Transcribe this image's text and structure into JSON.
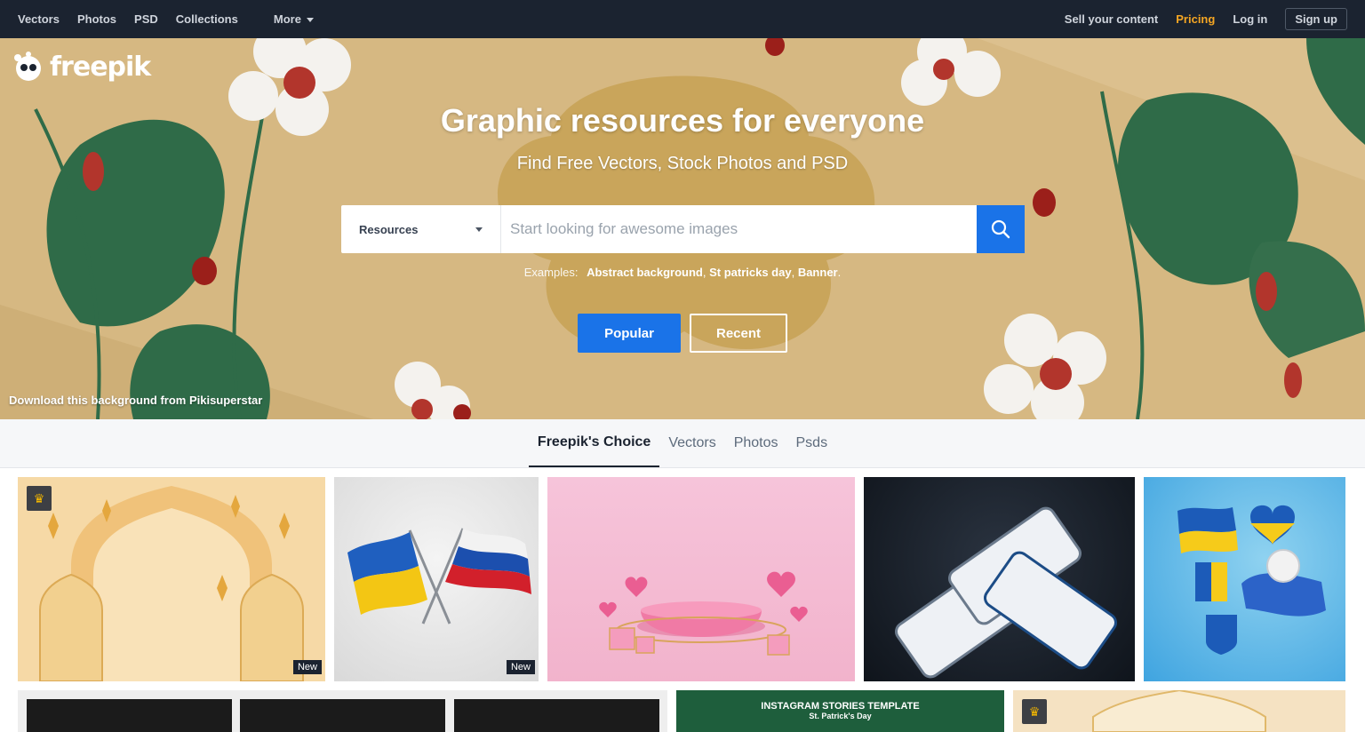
{
  "nav": {
    "left": [
      "Vectors",
      "Photos",
      "PSD",
      "Collections"
    ],
    "more_label": "More",
    "sell_label": "Sell your content",
    "pricing_label": "Pricing",
    "login_label": "Log in",
    "signup_label": "Sign up"
  },
  "brand": {
    "name": "freepik"
  },
  "hero": {
    "title": "Graphic resources for everyone",
    "subtitle": "Find Free Vectors, Stock Photos and PSD",
    "credit": "Download this background from Pikisuperstar"
  },
  "search": {
    "category": "Resources",
    "placeholder": "Start looking for awesome images",
    "value": ""
  },
  "examples": {
    "label": "Examples:",
    "items": [
      "Abstract background",
      "St patricks day",
      "Banner"
    ]
  },
  "hero_buttons": {
    "popular": "Popular",
    "recent": "Recent"
  },
  "tabs": [
    "Freepik's Choice",
    "Vectors",
    "Photos",
    "Psds"
  ],
  "badges": {
    "new": "New"
  },
  "thumbs": {
    "instagram_title": "INSTAGRAM STORIES TEMPLATE",
    "instagram_sub": "St. Patrick's Day"
  },
  "colors": {
    "nav_bg": "#1b2330",
    "accent": "#1a73e8",
    "pricing": "#f5a623",
    "hero_bg": "#d6b882"
  }
}
